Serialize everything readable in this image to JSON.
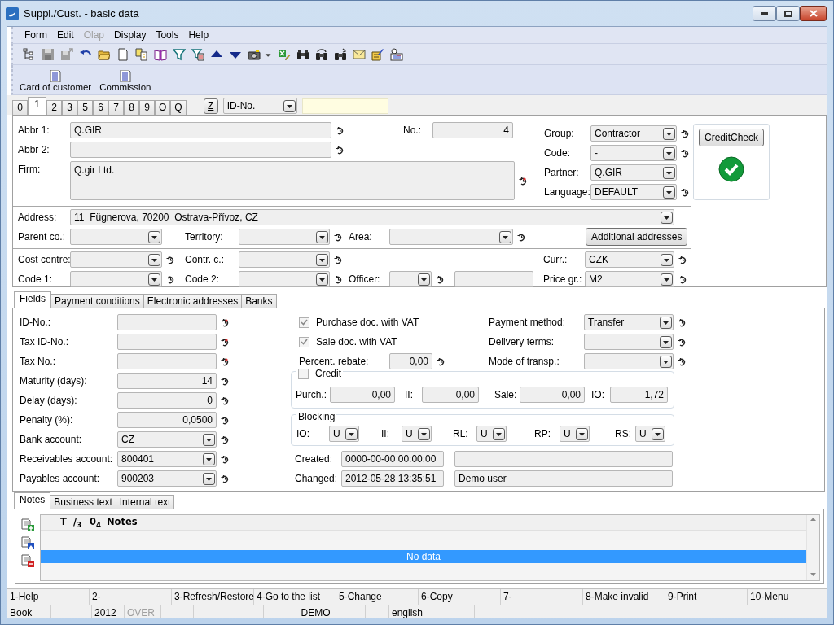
{
  "window": {
    "title": "Suppl./Cust. - basic data"
  },
  "menu": [
    {
      "label": "Form",
      "disabled": false
    },
    {
      "label": "Edit",
      "disabled": false
    },
    {
      "label": "Olap",
      "disabled": true
    },
    {
      "label": "Display",
      "disabled": false
    },
    {
      "label": "Tools",
      "disabled": false
    },
    {
      "label": "Help",
      "disabled": false
    }
  ],
  "shortcuts": [
    {
      "label": "Card of customer"
    },
    {
      "label": "Commission"
    }
  ],
  "record_tabs": [
    {
      "label": "0",
      "selected": false
    },
    {
      "label": "1",
      "selected": true
    },
    {
      "label": "2",
      "selected": false
    },
    {
      "label": "3",
      "selected": false
    },
    {
      "label": "5",
      "selected": false
    },
    {
      "label": "6",
      "selected": false
    },
    {
      "label": "7",
      "selected": false
    },
    {
      "label": "8",
      "selected": false
    },
    {
      "label": "9",
      "selected": false
    },
    {
      "label": "O",
      "selected": false
    },
    {
      "label": "Q",
      "selected": false
    }
  ],
  "lookup": {
    "key": "Z",
    "field": {
      "kind": "combo",
      "value": "ID-No."
    }
  },
  "main": {
    "abbr_1": {
      "label": "Abbr 1:",
      "kind": "text",
      "value": "Q.GIR",
      "history": true
    },
    "abbr_2": {
      "label": "Abbr 2:",
      "kind": "text",
      "history": true
    },
    "firm": {
      "label": "Firm:",
      "kind": "area",
      "value": "Q.gir Ltd.",
      "history": true,
      "changed": true
    },
    "no": {
      "label": "No.:",
      "kind": "number",
      "value": "4"
    },
    "group": {
      "label": "Group:",
      "kind": "combo",
      "value": "Contractor",
      "history": true
    },
    "code": {
      "label": "Code:",
      "kind": "combo",
      "value": "-",
      "history": true
    },
    "partner": {
      "label": "Partner:",
      "kind": "combo",
      "value": "Q.GIR"
    },
    "language": {
      "label": "Language:",
      "kind": "combo",
      "value": "DEFAULT",
      "history": true
    },
    "credit_check": {
      "label": "CreditCheck",
      "passed": true
    },
    "address": {
      "label": "Address:",
      "kind": "combo",
      "value": "11  Fügnerova, 70200  Ostrava-Přívoz, CZ"
    },
    "parent_co": {
      "label": "Parent co.:",
      "kind": "combo"
    },
    "territory": {
      "label": "Territory:",
      "kind": "combo",
      "history": true
    },
    "area": {
      "label": "Area:",
      "kind": "combo",
      "history": true
    },
    "additional_addresses": {
      "label": "Additional addresses"
    },
    "cost_centre": {
      "label": "Cost centre:",
      "kind": "combo",
      "history": true
    },
    "contr_c": {
      "label": "Contr. c.:",
      "kind": "combo",
      "history": true
    },
    "curr": {
      "label": "Curr.:",
      "kind": "combo",
      "value": "CZK",
      "history": true
    },
    "code_1": {
      "label": "Code 1:",
      "kind": "combo",
      "history": true
    },
    "code_2": {
      "label": "Code 2:",
      "kind": "combo",
      "history": true
    },
    "officer": {
      "label": "Officer:",
      "kind": "combo",
      "history": true
    },
    "officer_name": {
      "kind": "text"
    },
    "price_gr": {
      "label": "Price gr.:",
      "kind": "combo",
      "value": "M2",
      "history": true
    }
  },
  "detail_tabs": [
    {
      "label": "Fields",
      "selected": true
    },
    {
      "label": "Payment conditions",
      "selected": false
    },
    {
      "label": "Electronic addresses",
      "selected": false
    },
    {
      "label": "Banks",
      "selected": false
    }
  ],
  "fields": [
    {
      "label": "ID-No.:",
      "kind": "text",
      "history": true,
      "changed": true
    },
    {
      "label": "Tax ID-No.:",
      "kind": "text",
      "history": true,
      "changed": true
    },
    {
      "label": "Tax No.:",
      "kind": "text",
      "history": true,
      "changed": true
    },
    {
      "label": "Maturity (days):",
      "kind": "number",
      "value": "14",
      "history": true
    },
    {
      "label": "Delay  (days):",
      "kind": "number",
      "value": "0",
      "history": true
    },
    {
      "label": "Penalty (%):",
      "kind": "number",
      "value": "0,0500",
      "history": true
    },
    {
      "label": "Bank account:",
      "kind": "combo",
      "value": "CZ",
      "history": true
    },
    {
      "label": "Receivables account:",
      "kind": "combo",
      "value": "800401",
      "history": true
    },
    {
      "label": "Payables account:",
      "kind": "combo",
      "value": "900203",
      "history": true
    }
  ],
  "options": [
    {
      "label": "Purchase doc. with VAT",
      "checked": true
    },
    {
      "label": "Sale doc. with VAT",
      "checked": true
    }
  ],
  "percent_rebate": {
    "label": "Percent. rebate:",
    "kind": "number",
    "value": "0,00",
    "history": true
  },
  "terms": [
    {
      "label": "Payment method:",
      "kind": "combo",
      "value": "Transfer",
      "history": true
    },
    {
      "label": "Delivery terms:",
      "kind": "combo",
      "history": true
    },
    {
      "label": "Mode of transp.:",
      "kind": "combo",
      "history": true
    }
  ],
  "credit": {
    "label": "Credit",
    "checked": false,
    "fields": [
      {
        "label": "Purch.:",
        "kind": "number",
        "value": "0,00"
      },
      {
        "label": "II:",
        "kind": "number",
        "value": "0,00"
      },
      {
        "label": "Sale:",
        "kind": "number",
        "value": "0,00"
      },
      {
        "label": "IO:",
        "kind": "number",
        "value": "1,72"
      }
    ]
  },
  "blocking": {
    "label": "Blocking",
    "fields": [
      {
        "label": "IO:",
        "kind": "combo",
        "value": "U"
      },
      {
        "label": "II:",
        "kind": "combo",
        "value": "U"
      },
      {
        "label": "RL:",
        "kind": "combo",
        "value": "U"
      },
      {
        "label": "RP:",
        "kind": "combo",
        "value": "U"
      },
      {
        "label": "RS:",
        "kind": "combo",
        "value": "U"
      }
    ]
  },
  "audit": [
    {
      "label": "Created:",
      "value": "0000-00-00 00:00:00"
    },
    {
      "label": "Changed:",
      "value": "2012-05-28 13:35:51",
      "user": "Demo user"
    }
  ],
  "notes_tabs": [
    {
      "label": "Notes",
      "selected": true
    },
    {
      "label": "Business text",
      "selected": false
    },
    {
      "label": "Internal text",
      "selected": false
    }
  ],
  "notes_table": {
    "columns": [
      "T",
      "/$_{3}$",
      "0$_{4}$",
      "Notes"
    ],
    "empty_text": "No data"
  },
  "function_keys": [
    "1-Help",
    "2-",
    "3-Refresh/Restore",
    "4-Go to the list",
    "5-Change",
    "6-Copy",
    "7-",
    "8-Make invalid",
    "9-Print",
    "10-Menu"
  ],
  "status_bar": [
    {
      "text": "Book",
      "disabled": false
    },
    {
      "text": "2012",
      "disabled": false
    },
    {
      "text": "OVER",
      "disabled": true
    },
    {
      "text": "DEMO",
      "disabled": false
    },
    {
      "text": "english",
      "disabled": false
    }
  ]
}
